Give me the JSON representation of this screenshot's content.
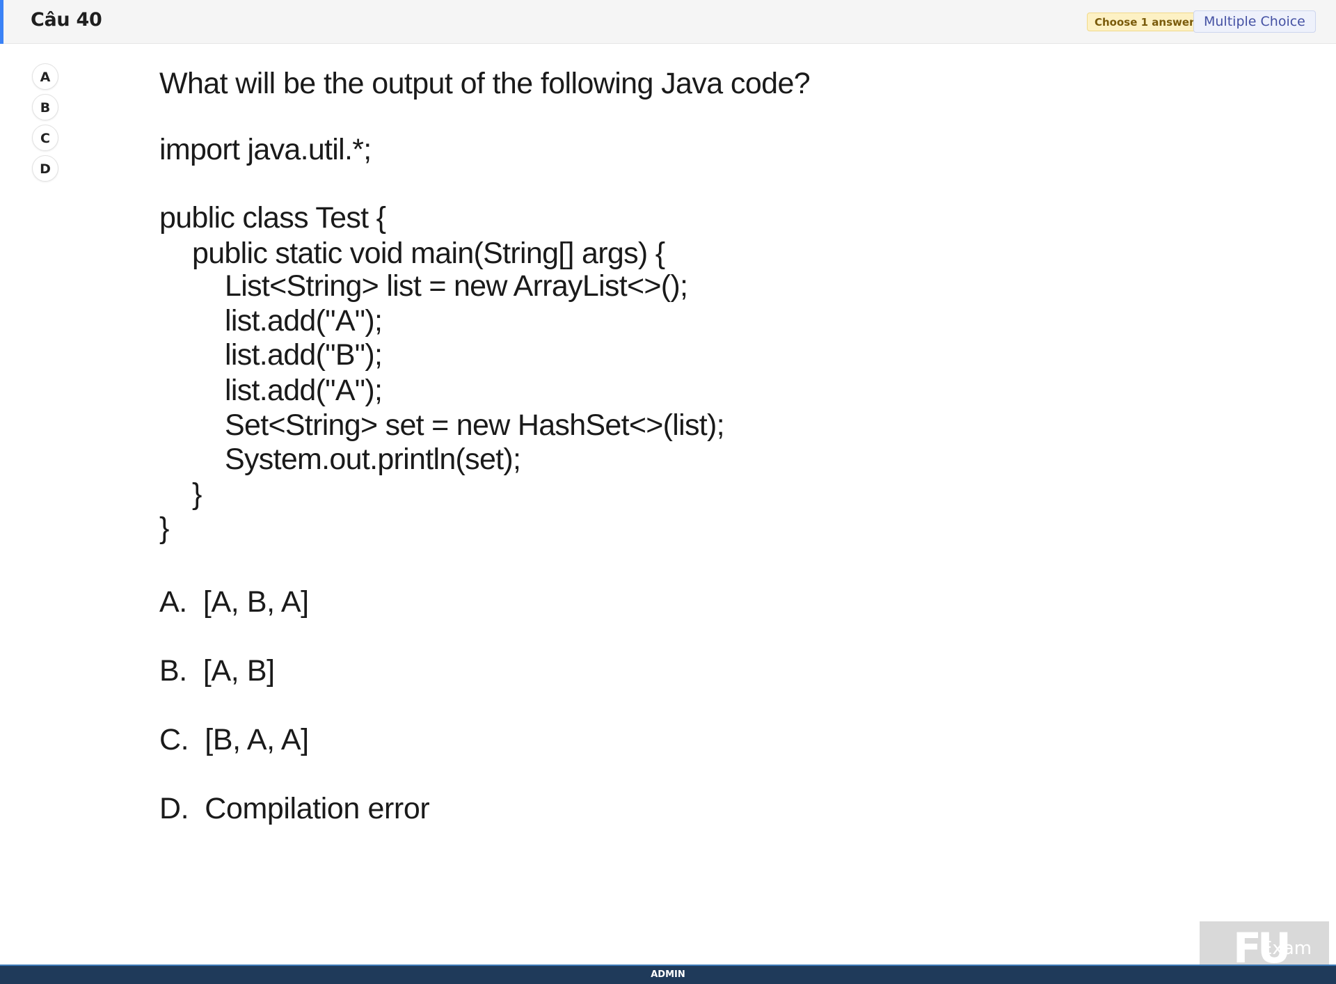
{
  "header": {
    "title": "Câu 40",
    "badge_choose": "Choose 1 answer",
    "badge_type": "Multiple Choice",
    "accent_color": "#3b82f6"
  },
  "answer_options": [
    "A",
    "B",
    "C",
    "D"
  ],
  "question": {
    "prompt": "What will be the output of the following Java code?",
    "code_lines": [
      "import java.util.*;",
      "public class Test {",
      "public static void main(String[] args) {",
      "List<String> list = new ArrayList<>();",
      "list.add(\"A\");",
      "list.add(\"B\");",
      "list.add(\"A\");",
      "Set<String> set = new HashSet<>(list);",
      "System.out.println(set);",
      "}",
      "}"
    ],
    "choices": [
      "A.  [A, B, A]",
      "B.  [A, B]",
      "C.  [B, A, A]",
      "D.  Compilation error"
    ]
  },
  "logo": {
    "mark": "FU",
    "word": "Exam"
  },
  "footer": {
    "label": "ADMIN",
    "color": "#1f3a5a"
  }
}
